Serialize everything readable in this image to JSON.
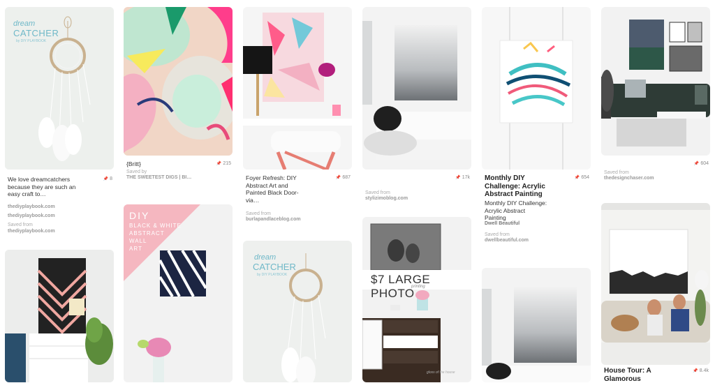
{
  "pins": [
    {
      "id": "dream",
      "title_top": "dream",
      "title_big": "CATCHER",
      "byline": "by DIY PLAYBOOK",
      "desc": "We love dreamcatchers because they are such an easy craft to…",
      "saves": "8",
      "source1": "thediyplaybook.com",
      "source2": "thediyplaybook.com",
      "saved_from_label": "Saved from",
      "source3": "thediyplaybook.com"
    },
    {
      "id": "britt",
      "desc": "{Britt}",
      "saves": "215",
      "saved_by_label": "Saved by",
      "saved_by": "THE SWEETEST DIGS | BI…"
    },
    {
      "id": "foyer",
      "desc": "Foyer Refresh: DIY Abstract Art and Painted Black Door-via…",
      "saves": "687",
      "saved_from_label": "Saved from",
      "source": "burlapandlaceblog.com"
    },
    {
      "id": "grey",
      "saves": "17k",
      "saved_from_label": "Saved from",
      "source": "stylizimoblog.com"
    },
    {
      "id": "monthly",
      "desc": "Monthly DIY Challenge: Acrylic Abstract Painting",
      "saves": "654",
      "sub": "Monthly DIY Challenge: Acrylic Abstract Painting",
      "board": "Dwell Beautiful",
      "saved_from_label": "Saved from",
      "source": "dwellbeautiful.com"
    },
    {
      "id": "living",
      "saves": "604",
      "saved_from_label": "Saved from",
      "source": "thedesignchaser.com"
    },
    {
      "id": "diybw",
      "title_big": "DIY",
      "title_lines": [
        "BLACK & WHITE",
        "ABSTRACT",
        "WALL",
        "ART"
      ]
    },
    {
      "id": "dream2",
      "title_top": "dream",
      "title_big": "CATCHER",
      "byline": "by DIY PLAYBOOK"
    },
    {
      "id": "photo",
      "banner": "$7 LARGE PHOTO",
      "banner_sub": "printing",
      "watermark": "gloss of the house"
    },
    {
      "id": "house",
      "desc": "House Tour: A Glamorous",
      "saves": "8.4k"
    }
  ]
}
